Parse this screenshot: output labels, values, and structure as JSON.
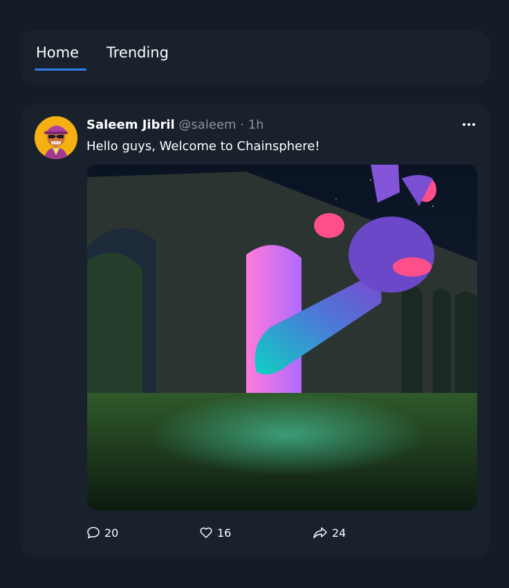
{
  "tabs": [
    {
      "label": "Home",
      "active": true
    },
    {
      "label": "Trending",
      "active": false
    }
  ],
  "accent_color": "#2f80ed",
  "post": {
    "author": "Saleem Jibril",
    "handle": "@saleem",
    "separator": "·",
    "time": "1h",
    "text": "Hello guys, Welcome to Chainsphere!",
    "avatar_icon": "ape-avatar",
    "more_icon": "ellipsis-icon",
    "image_alt": "Neon hand reaching from glowing arch in a stone viaduct at night",
    "actions": {
      "comments": "20",
      "likes": "16",
      "shares": "24"
    }
  }
}
